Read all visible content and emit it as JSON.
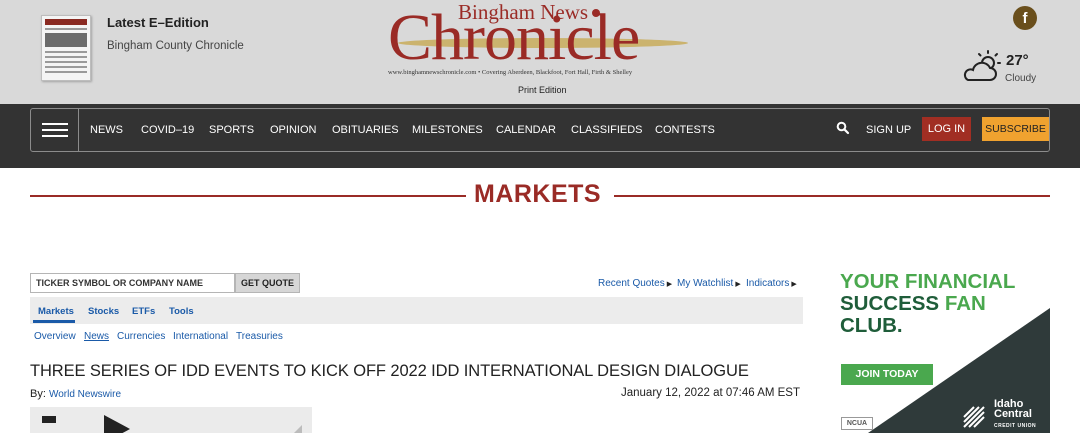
{
  "header": {
    "eedition_title": "Latest E–Edition",
    "eedition_sub": "Bingham County Chronicle",
    "logo_top": "Bingham News",
    "logo_main": "Chronicle",
    "logo_tagline": "www.binghamnewschronicle.com • Covering Aberdeen, Blackfoot, Fort Hall, Firth & Shelley",
    "print_edition": "Print Edition",
    "facebook_glyph": "f",
    "weather_temp": "27°",
    "weather_cond": "Cloudy"
  },
  "nav": {
    "items": [
      "NEWS",
      "COVID–19",
      "SPORTS",
      "OPINION",
      "OBITUARIES",
      "MILESTONES",
      "CALENDAR",
      "CLASSIFIEDS",
      "CONTESTS"
    ],
    "signup": "SIGN UP",
    "login": "LOG IN",
    "subscribe": "SUBSCRIBE"
  },
  "page": {
    "title": "MARKETS"
  },
  "quote": {
    "placeholder": "TICKER SYMBOL OR COMPANY NAME",
    "button": "GET QUOTE",
    "links": [
      "Recent Quotes",
      "My Watchlist",
      "Indicators"
    ],
    "tabs": [
      "Markets",
      "Stocks",
      "ETFs",
      "Tools"
    ],
    "subtabs": [
      "Overview",
      "News",
      "Currencies",
      "International",
      "Treasuries"
    ]
  },
  "article": {
    "headline": "THREE SERIES OF IDD EVENTS TO KICK OFF 2022 IDD INTERNATIONAL DESIGN DIALOGUE",
    "by_label": "By:",
    "by_source": "World Newswire",
    "date": "January 12, 2022 at 07:46 AM EST"
  },
  "ad": {
    "head_line1": "YOUR FINANCIAL",
    "head_line2_a": "SUCCESS ",
    "head_line2_b": "FAN",
    "head_line3": "CLUB.",
    "button": "JOIN TODAY",
    "ncua": "NCUA",
    "brand1": "Idaho",
    "brand2": "Central",
    "brand3": "CREDIT UNION"
  },
  "icons": [
    "facebook-icon",
    "weather-partly-cloudy-icon",
    "menu-icon",
    "search-icon",
    "play-icon"
  ],
  "colors": {
    "brand_red": "#9a2b26",
    "nav_bg": "#333333",
    "login": "#a12e23",
    "subscribe": "#f0a22f",
    "link": "#1a5aa8",
    "ad_green": "#4aa84e"
  }
}
